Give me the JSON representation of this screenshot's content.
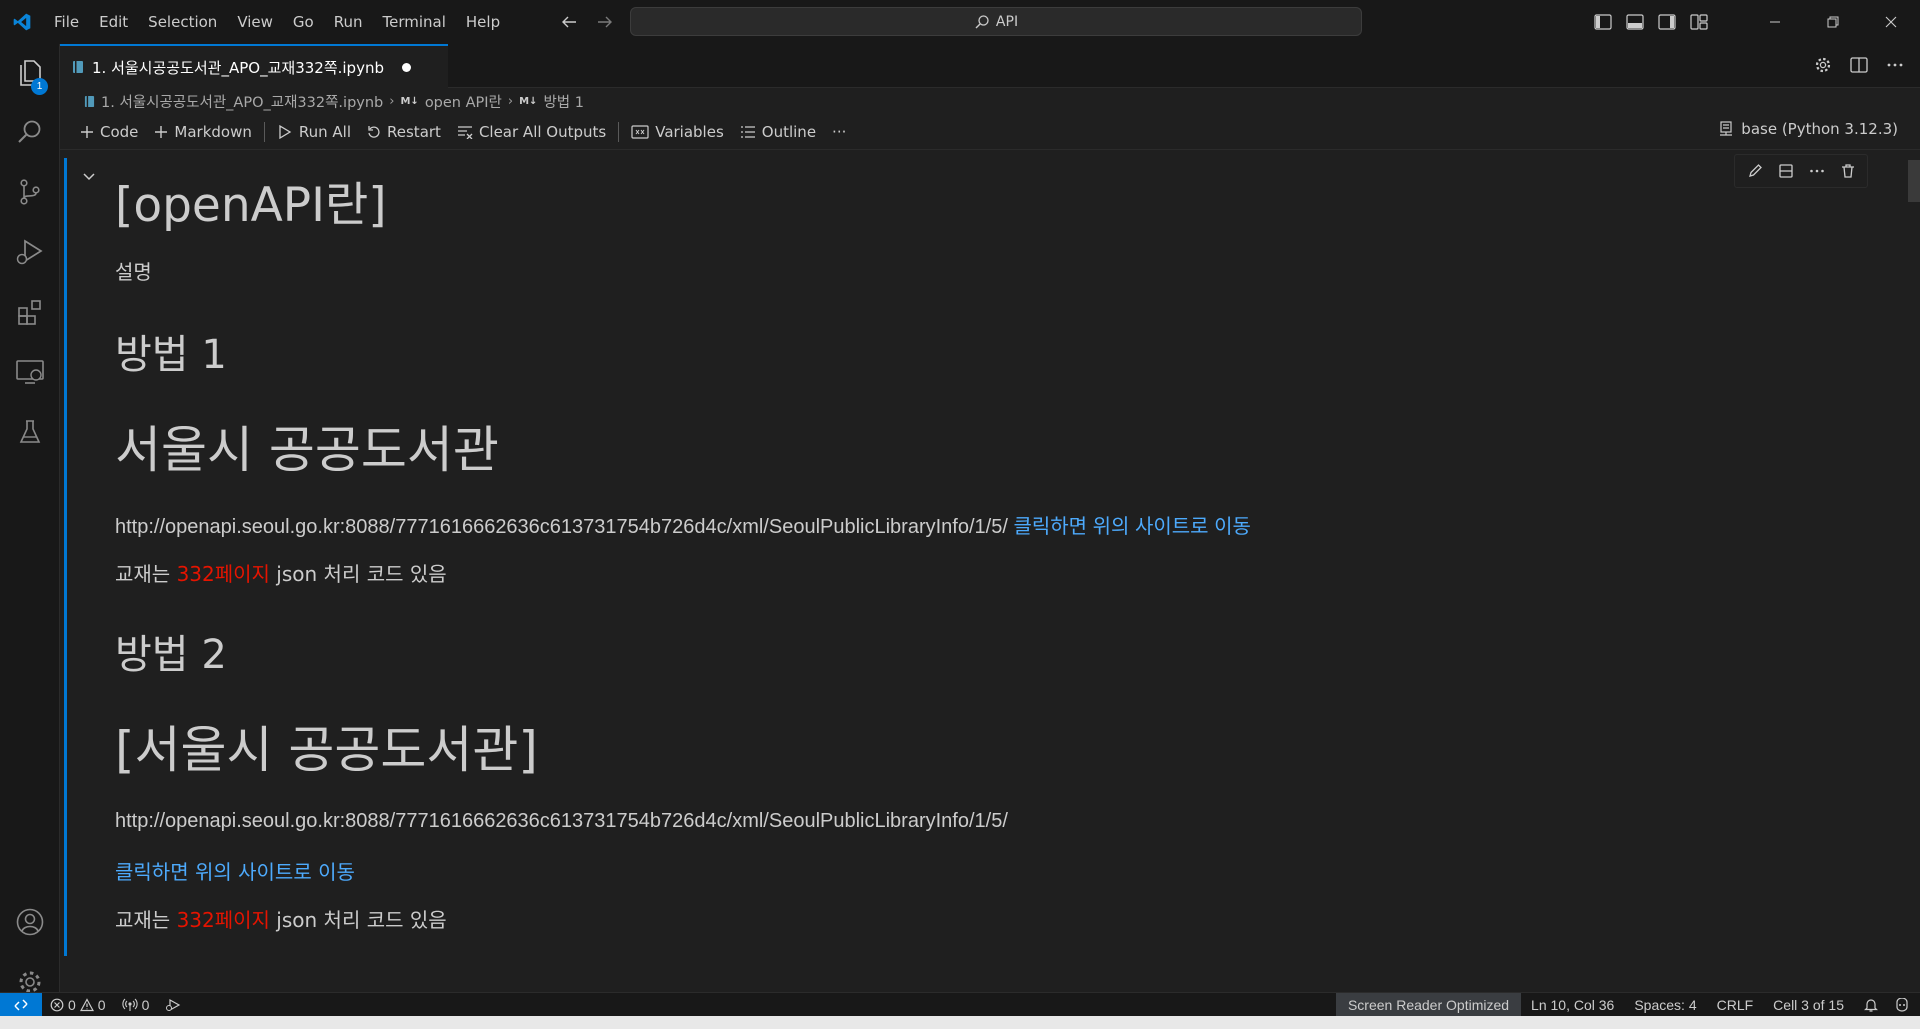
{
  "titlebar": {
    "menu": [
      "File",
      "Edit",
      "Selection",
      "View",
      "Go",
      "Run",
      "Terminal",
      "Help"
    ],
    "search_text": "API",
    "icons": [
      "vscode-logo-icon",
      "back-arrow-icon",
      "forward-arrow-icon",
      "search-icon",
      "toggle-primary-sidebar-icon",
      "toggle-panel-icon",
      "toggle-secondary-sidebar-icon",
      "customize-layout-icon",
      "minimize-icon",
      "restore-icon",
      "close-icon"
    ]
  },
  "activitybar": {
    "explorer_badge": "1",
    "icons": [
      "explorer-icon",
      "search-icon",
      "source-control-icon",
      "run-debug-icon",
      "extensions-icon",
      "remote-explorer-icon",
      "testing-icon",
      "accounts-icon",
      "manage-gear-icon"
    ]
  },
  "tab": {
    "label": "1. 서울시공공도서관_APO_교재332쪽.ipynb"
  },
  "breadcrumb": {
    "file": "1. 서울시공공도서관_APO_교재332쪽.ipynb",
    "md_marker": "M↓",
    "section1": "open API란",
    "section2": "방법 1"
  },
  "toolbar": {
    "code": "Code",
    "markdown": "Markdown",
    "run_all": "Run All",
    "restart": "Restart",
    "clear_outputs": "Clear All Outputs",
    "variables": "Variables",
    "outline": "Outline",
    "more": "···",
    "kernel": "base (Python 3.12.3)"
  },
  "cell": {
    "heading": "[openAPI란]",
    "desc": "설명",
    "method1": "방법 1",
    "title1": "서울시 공공도서관",
    "url1": "http://openapi.seoul.go.kr:8088/7771616662636c613731754b726d4c/xml/SeoulPublicLibraryInfo/1/5/",
    "link1": "클릭하면 위의 사이트로 이동",
    "note1_pre": "교재는 ",
    "note1_red": "332페이지",
    "note1_post": " json 처리 코드 있음",
    "method2": "방법 2",
    "title2": "[서울시 공공도서관]",
    "url2": "http://openapi.seoul.go.kr:8088/7771616662636c613731754b726d4c/xml/SeoulPublicLibraryInfo/1/5/",
    "link2": "클릭하면 위의 사이트로 이동",
    "note2_pre": "교재는 ",
    "note2_red": "332페이지",
    "note2_post": " json 처리 코드 있음"
  },
  "statusbar": {
    "errors": "0",
    "warnings": "0",
    "ports": "0",
    "screen_reader": "Screen Reader Optimized",
    "position": "Ln 10, Col 36",
    "spaces": "Spaces: 4",
    "eol": "CRLF",
    "cell": "Cell 3 of 15"
  },
  "colors": {
    "accent": "#0078d4",
    "link": "#4daafc",
    "highlight_red": "#e51400",
    "background": "#1f1f1f"
  }
}
